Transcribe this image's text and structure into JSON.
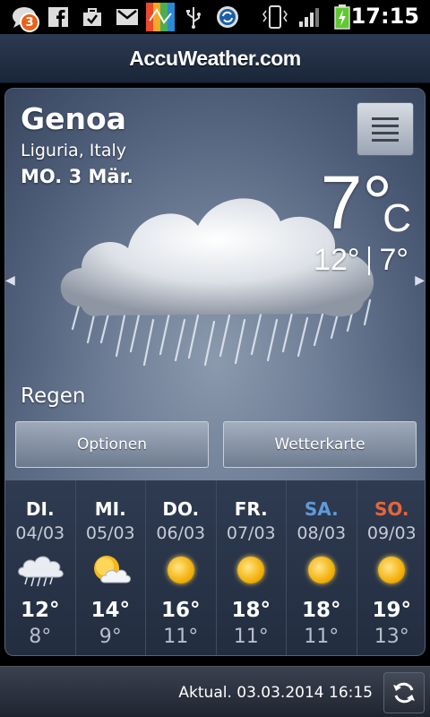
{
  "status_bar": {
    "time": "17:15",
    "notification_count": "3",
    "icons": [
      "chat-icon",
      "facebook-icon",
      "briefcase-icon",
      "gmail-icon",
      "avast-icon",
      "usb-icon",
      "sync-icon",
      "vibrate-icon",
      "signal-icon",
      "battery-charging-icon"
    ]
  },
  "header": {
    "logo": "AccuWeather.com"
  },
  "current": {
    "city": "Genoa",
    "region": "Liguria, Italy",
    "date": "MO. 3 Mär.",
    "temp": "7°",
    "unit": "C",
    "high": "12°",
    "low": "7°",
    "condition": "Regen"
  },
  "buttons": {
    "options": "Optionen",
    "map": "Wetterkarte"
  },
  "forecast": [
    {
      "day": "DI.",
      "date": "04/03",
      "hi": "12°",
      "lo": "8°",
      "icon": "cloud-rain-icon",
      "color": "#ffffff"
    },
    {
      "day": "MI.",
      "date": "05/03",
      "hi": "14°",
      "lo": "9°",
      "icon": "sun-cloud-icon",
      "color": "#ffffff"
    },
    {
      "day": "DO.",
      "date": "06/03",
      "hi": "16°",
      "lo": "11°",
      "icon": "sun-icon",
      "color": "#ffffff"
    },
    {
      "day": "FR.",
      "date": "07/03",
      "hi": "18°",
      "lo": "11°",
      "icon": "sun-icon",
      "color": "#ffffff"
    },
    {
      "day": "SA.",
      "date": "08/03",
      "hi": "18°",
      "lo": "11°",
      "icon": "sun-icon",
      "color": "#5f9bd8"
    },
    {
      "day": "SO.",
      "date": "09/03",
      "hi": "19°",
      "lo": "13°",
      "icon": "sun-icon",
      "color": "#e8653a"
    }
  ],
  "footer": {
    "updated": "Aktual. 03.03.2014 16:15"
  }
}
